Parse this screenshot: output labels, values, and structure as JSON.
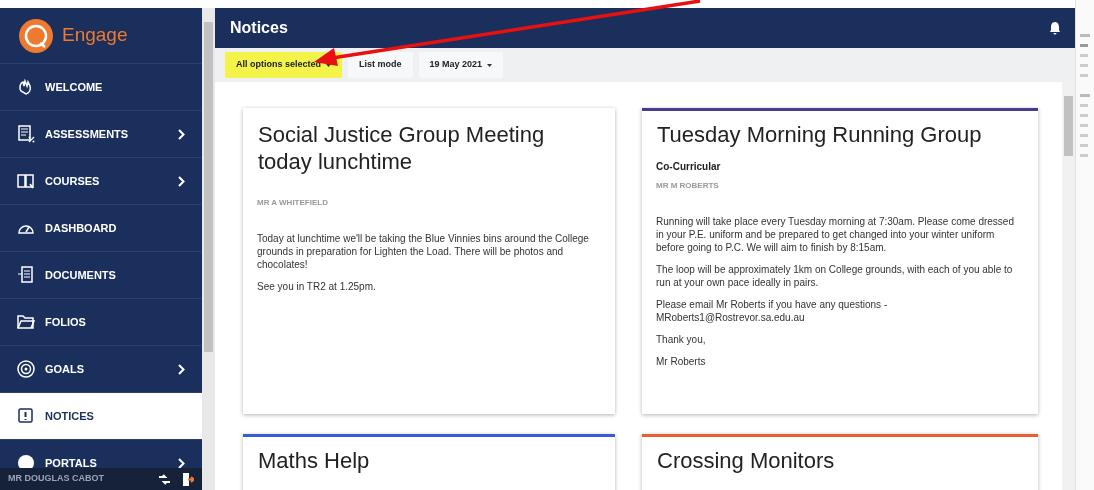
{
  "brand": {
    "name": "Engage"
  },
  "sidebar": {
    "items": [
      {
        "label": "WELCOME",
        "has_submenu": false,
        "selected": false
      },
      {
        "label": "ASSESSMENTS",
        "has_submenu": true,
        "selected": false
      },
      {
        "label": "COURSES",
        "has_submenu": true,
        "selected": false
      },
      {
        "label": "DASHBOARD",
        "has_submenu": false,
        "selected": false
      },
      {
        "label": "DOCUMENTS",
        "has_submenu": false,
        "selected": false
      },
      {
        "label": "FOLIOS",
        "has_submenu": false,
        "selected": false
      },
      {
        "label": "GOALS",
        "has_submenu": true,
        "selected": false
      },
      {
        "label": "NOTICES",
        "has_submenu": false,
        "selected": true
      },
      {
        "label": "PORTALS",
        "has_submenu": true,
        "selected": false
      }
    ],
    "user": "MR DOUGLAS CABOT"
  },
  "header": {
    "title": "Notices"
  },
  "toolbar": [
    {
      "kind": "dropdown",
      "label": "All options selected",
      "highlighted": true
    },
    {
      "kind": "button",
      "label": "List mode",
      "highlighted": false
    },
    {
      "kind": "dropdown",
      "label": "19 May 2021",
      "highlighted": false
    }
  ],
  "notices": [
    {
      "title": "Social Justice Group Meeting today lunchtime",
      "color": "#ffffff",
      "author": "MR A WHITEFIELD",
      "paragraphs": [
        "Today at lunchtime we'll be taking the Blue Vinnies bins around the College grounds in preparation for Lighten the Load. There will be photos and chocolates!",
        "See you in TR2 at 1.25pm."
      ]
    },
    {
      "title": "Tuesday Morning Running Group",
      "color": "#4b3a8c",
      "category": "Co-Curricular",
      "author": "MR M ROBERTS",
      "paragraphs": [
        "Running will take place every Tuesday morning at 7:30am. Please come dressed in your P.E. uniform and be prepared to get changed into your winter uniform before going to P.C. We will aim to finish by 8:15am.",
        "The loop will be approximately 1km on College grounds, with each of you able to run at your own pace ideally in pairs.",
        "Please email Mr Roberts if you have any questions - MRoberts1@Rostrevor.sa.edu.au",
        "Thank you,",
        "Mr Roberts"
      ]
    },
    {
      "title": "Maths Help",
      "color": "#3a5bd0"
    },
    {
      "title": "Crossing Monitors",
      "color": "#e8602c"
    }
  ],
  "annotation": {
    "arrow": true
  }
}
